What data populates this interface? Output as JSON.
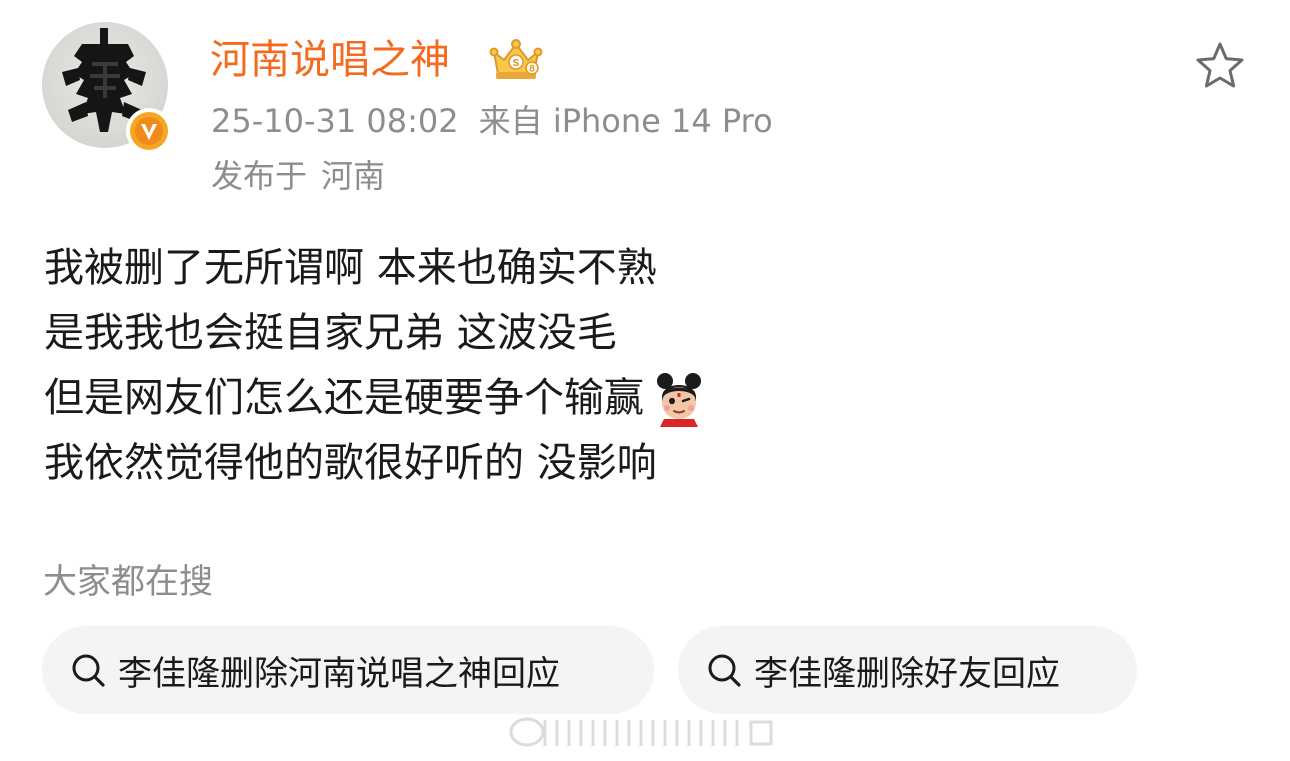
{
  "post": {
    "username": "河南说唱之神",
    "timestamp": "25-10-31 08:02",
    "source": "来自 iPhone 14 Pro",
    "location_prefix": "发布于",
    "location": "河南",
    "lines": [
      "我被删了无所谓啊 本来也确实不熟",
      "是我我也会挺自家兄弟 这波没毛",
      "但是网友们怎么还是硬要争个输赢",
      "我依然觉得他的歌很好听的 没影响"
    ]
  },
  "search": {
    "header": "大家都在搜",
    "chips": [
      "李佳隆删除河南说唱之神回应",
      "李佳隆删除好友回应"
    ]
  },
  "icons": {
    "avatar": "avatar",
    "verified": "verified-v-icon",
    "crown": "crown-badge-icon",
    "favorite": "star-icon",
    "emoji": "nezha-emoji",
    "search": "search-icon"
  },
  "colors": {
    "username": "#f46a1f",
    "meta": "#8d8d8d",
    "verified_badge": "#f5a623",
    "chip_background": "#f4f4f4"
  }
}
